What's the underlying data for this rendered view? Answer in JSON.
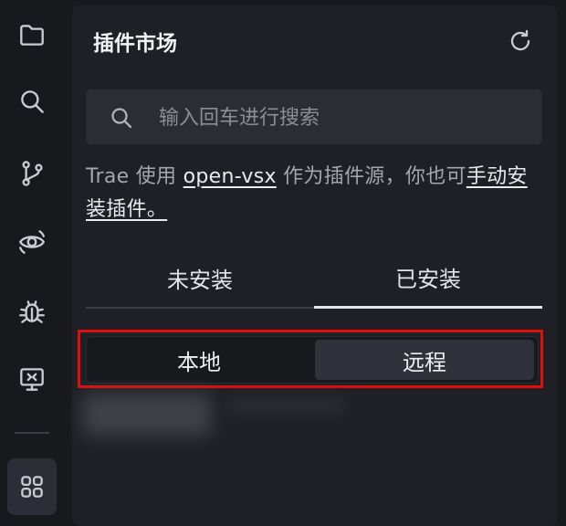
{
  "activity_bar": {
    "items": [
      {
        "name": "explorer",
        "icon": "folder-icon"
      },
      {
        "name": "search",
        "icon": "search-icon"
      },
      {
        "name": "source-control",
        "icon": "git-branch-icon"
      },
      {
        "name": "remote",
        "icon": "eye-icon"
      },
      {
        "name": "debug",
        "icon": "bug-icon"
      },
      {
        "name": "remote-explorer",
        "icon": "monitor-remote-icon"
      },
      {
        "name": "extensions",
        "icon": "extensions-grid-icon",
        "active": true
      }
    ]
  },
  "panel": {
    "title": "插件市场",
    "refresh_icon": "refresh-icon"
  },
  "search": {
    "placeholder": "输入回车进行搜索",
    "value": ""
  },
  "notice": {
    "prefix": "Trae 使用 ",
    "link_source": "open-vsx",
    "middle": " 作为插件源，你也可",
    "link_manual": "手动安装插件。"
  },
  "tabs": {
    "not_installed": "未安装",
    "installed": "已安装",
    "selected": "installed"
  },
  "scope": {
    "local": "本地",
    "remote": "远程",
    "selected": "remote"
  },
  "colors": {
    "highlight": "#e00d0d",
    "panel_bg": "#1f2026",
    "app_bg": "#18191d"
  }
}
